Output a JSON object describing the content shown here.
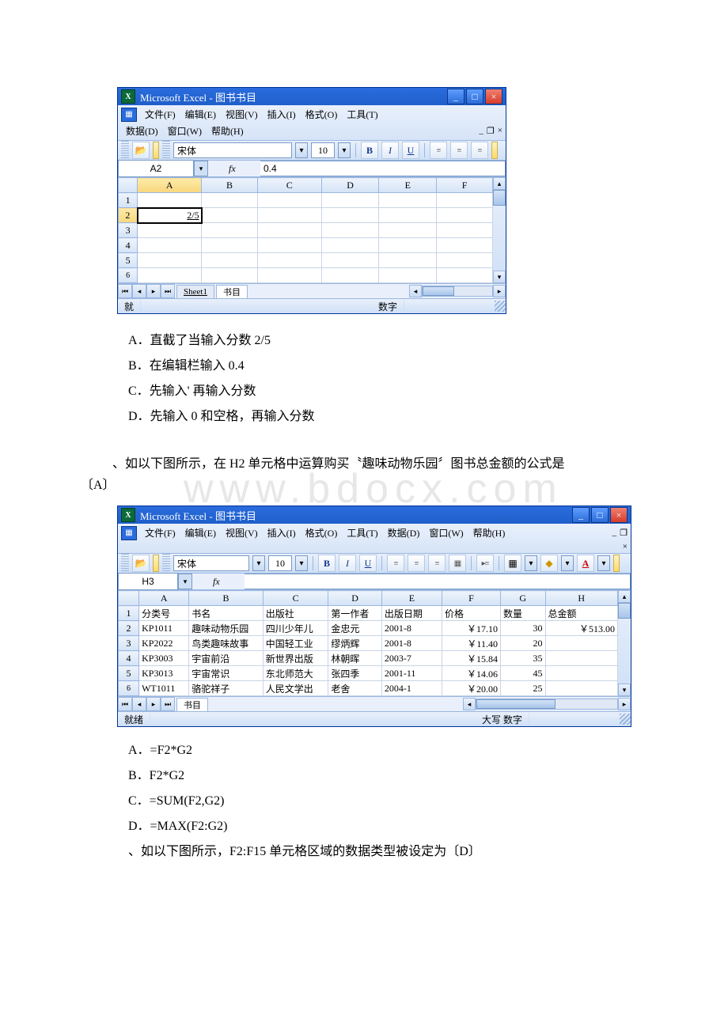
{
  "excel1": {
    "title": "Microsoft Excel - 图书书目",
    "menus": {
      "file": "文件(F)",
      "edit": "编辑(E)",
      "view": "视图(V)",
      "insert": "插入(I)",
      "format": "格式(O)",
      "tools": "工具(T)",
      "data": "数据(D)",
      "window": "窗口(W)",
      "help": "帮助(H)"
    },
    "font_name": "宋体",
    "font_size": "10",
    "namebox": "A2",
    "fx_label": "fx",
    "formula_bar": "0.4",
    "cols": [
      "A",
      "B",
      "C",
      "D",
      "E",
      "F"
    ],
    "rows": [
      "1",
      "2",
      "3",
      "4",
      "5",
      "6"
    ],
    "active_cell_value": "2/5",
    "sheet_tabs": {
      "t1": "Sheet1",
      "t2": "书目"
    },
    "status_left": "就",
    "status_mid": "数字"
  },
  "q1": {
    "optA": "A．直截了当输入分数 2/5",
    "optB": "B．在编辑栏输入 0.4",
    "optC": "C．先输入' 再输入分数",
    "optD": "D．先输入 0 和空格，再输入分数"
  },
  "q2_stem": {
    "line1": "、如以下图所示，在 H2 单元格中运算购买〝趣味动物乐园〞图书总金额的公式是",
    "line2": "〔A〕"
  },
  "watermark": "www.bdocx.com",
  "excel2": {
    "title": "Microsoft Excel - 图书书目",
    "menus": {
      "file": "文件(F)",
      "edit": "编辑(E)",
      "view": "视图(V)",
      "insert": "插入(I)",
      "format": "格式(O)",
      "tools": "工具(T)",
      "data": "数据(D)",
      "window": "窗口(W)",
      "help": "帮助(H)"
    },
    "font_name": "宋体",
    "font_size": "10",
    "namebox": "H3",
    "fx_label": "fx",
    "formula_bar": "",
    "cols": [
      "A",
      "B",
      "C",
      "D",
      "E",
      "F",
      "G",
      "H"
    ],
    "headers": [
      "分类号",
      "书名",
      "出版社",
      "第一作者",
      "出版日期",
      "价格",
      "数量",
      "总金额"
    ],
    "rows": [
      {
        "n": "2",
        "a": "KP1011",
        "b": "趣味动物乐园",
        "c": "四川少年儿",
        "d": "金忠元",
        "e": "2001-8",
        "f": "￥17.10",
        "g": "30",
        "h": "￥513.00"
      },
      {
        "n": "3",
        "a": "KP2022",
        "b": "鸟类趣味故事",
        "c": "中国轻工业",
        "d": "缪炳辉",
        "e": "2001-8",
        "f": "￥11.40",
        "g": "20",
        "h": ""
      },
      {
        "n": "4",
        "a": "KP3003",
        "b": "宇宙前沿",
        "c": "新世界出版",
        "d": "林朝晖",
        "e": "2003-7",
        "f": "￥15.84",
        "g": "35",
        "h": ""
      },
      {
        "n": "5",
        "a": "KP3013",
        "b": "宇宙常识",
        "c": "东北师范大",
        "d": "张四季",
        "e": "2001-11",
        "f": "￥14.06",
        "g": "45",
        "h": ""
      },
      {
        "n": "6",
        "a": "WT1011",
        "b": "骆驼祥子",
        "c": "人民文学出",
        "d": "老舍",
        "e": "2004-1",
        "f": "￥20.00",
        "g": "25",
        "h": ""
      }
    ],
    "sheet_tabs": {
      "t1": "书目"
    },
    "status_left": "就绪",
    "status_mid": "大写  数字"
  },
  "q2": {
    "optA": "A．=F2*G2",
    "optB": "B．F2*G2",
    "optC": "C．=SUM(F2,G2)",
    "optD": "D．=MAX(F2:G2)"
  },
  "q3_stem": "、如以下图所示，F2:F15 单元格区域的数据类型被设定为〔D〕"
}
